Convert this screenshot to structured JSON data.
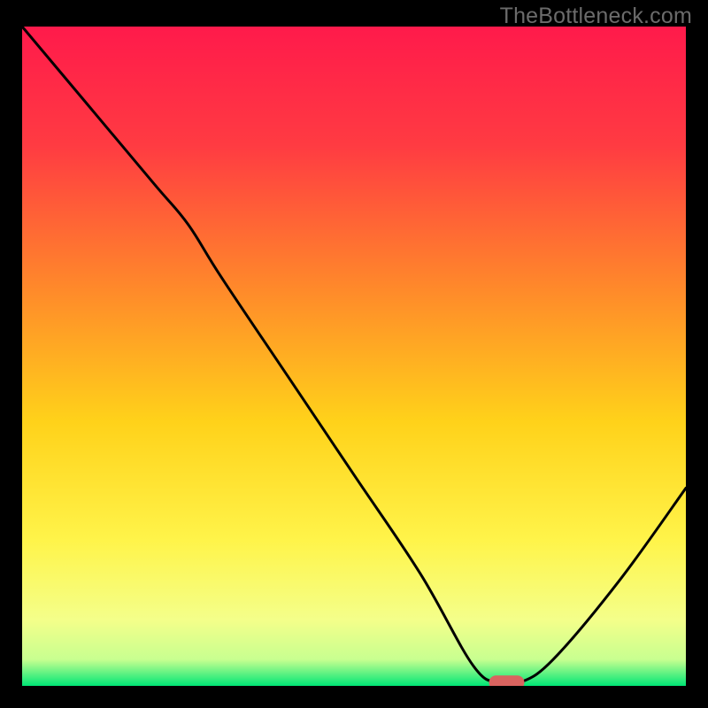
{
  "watermark": "TheBottleneck.com",
  "chart_data": {
    "type": "line",
    "title": "",
    "xlabel": "",
    "ylabel": "",
    "xlim": [
      0,
      100
    ],
    "ylim": [
      0,
      100
    ],
    "series": [
      {
        "name": "curve",
        "x": [
          0,
          10,
          20,
          25,
          30,
          40,
          50,
          60,
          68,
          72,
          75,
          80,
          90,
          100
        ],
        "y": [
          100,
          88,
          76,
          70,
          62,
          47,
          32,
          17,
          3,
          0.5,
          0.5,
          4,
          16,
          30
        ]
      }
    ],
    "marker": {
      "x": 73,
      "y": 0.5
    },
    "gradient_stops": [
      {
        "offset": 0.0,
        "color": "#ff1a4b"
      },
      {
        "offset": 0.18,
        "color": "#ff3b42"
      },
      {
        "offset": 0.4,
        "color": "#ff8a2a"
      },
      {
        "offset": 0.6,
        "color": "#ffd21a"
      },
      {
        "offset": 0.78,
        "color": "#fff44a"
      },
      {
        "offset": 0.9,
        "color": "#f4ff8a"
      },
      {
        "offset": 0.96,
        "color": "#c8ff90"
      },
      {
        "offset": 1.0,
        "color": "#00e676"
      }
    ],
    "curve_color": "#000000",
    "marker_color": "#d9635f"
  }
}
